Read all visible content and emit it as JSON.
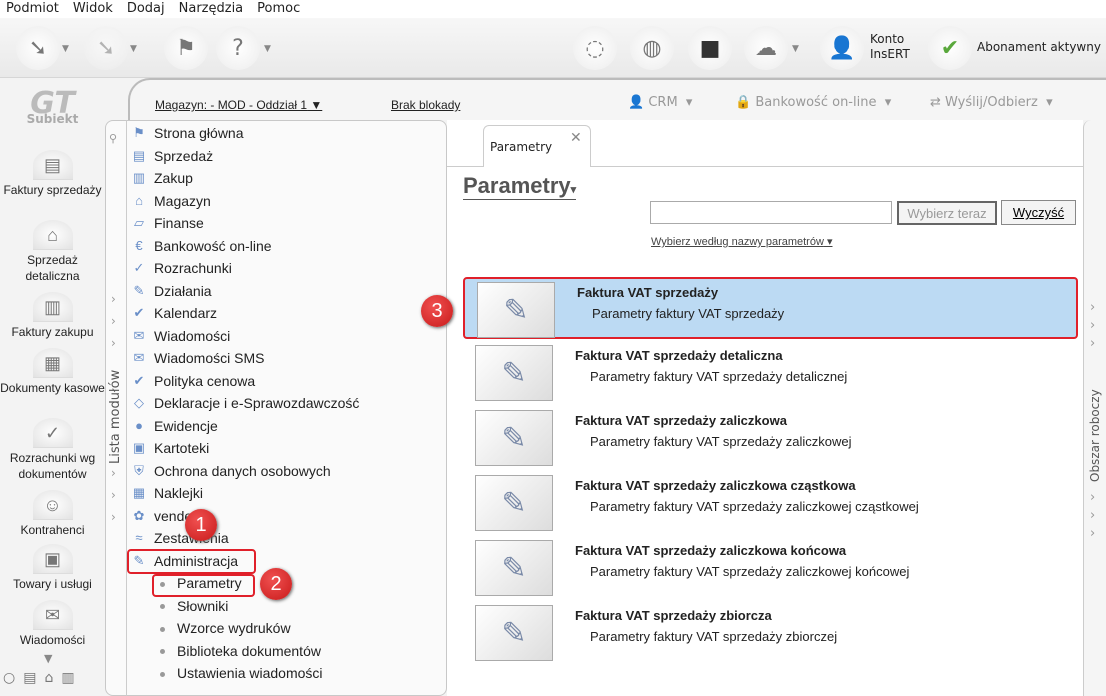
{
  "menu": [
    "Podmiot",
    "Widok",
    "Dodaj",
    "Narzędzia",
    "Pomoc"
  ],
  "toolbar": {
    "account_line1": "Konto",
    "account_line2": "InsERT",
    "subscription": "Abonament aktywny",
    "logo_text": "Subiekt"
  },
  "sidebar": [
    "Faktury sprzedaży",
    "Sprzedaż detaliczna",
    "Faktury zakupu",
    "Dokumenty kasowe",
    "Rozrachunki wg dokumentów",
    "Kontrahenci",
    "Towary i usługi",
    "Wiadomości"
  ],
  "panelbar": {
    "warehouse": "Magazyn: - MOD - Oddział 1",
    "lock": "Brak blokady",
    "crm": "CRM",
    "banking": "Bankowość on-line",
    "send": "Wyślij/Odbierz"
  },
  "modules_tab": "Lista modułów",
  "modules": [
    "Strona główna",
    "Sprzedaż",
    "Zakup",
    "Magazyn",
    "Finanse",
    "Bankowość on-line",
    "Rozrachunki",
    "Działania",
    "Kalendarz",
    "Wiadomości",
    "Wiadomości SMS",
    "Polityka cenowa",
    "Deklaracje i e-Sprawozdawczość",
    "Ewidencje",
    "Kartoteki",
    "Ochrona danych osobowych",
    "Naklejki",
    "vendero",
    "Zestawienia",
    "Administracja"
  ],
  "submodules": [
    "Parametry",
    "Słowniki",
    "Wzorce wydruków",
    "Biblioteka dokumentów",
    "Ustawienia wiadomości"
  ],
  "content": {
    "tab": "Parametry",
    "title": "Parametry",
    "search_value": "",
    "choose_btn": "Wybierz teraz",
    "clear_btn": "Wyczyść",
    "filter_link": "Wybierz według nazwy parametrów",
    "items": [
      {
        "title": "Faktura VAT sprzedaży",
        "desc": "Parametry faktury VAT sprzedaży"
      },
      {
        "title": "Faktura VAT sprzedaży detaliczna",
        "desc": "Parametry faktury VAT sprzedaży detalicznej"
      },
      {
        "title": "Faktura VAT sprzedaży zaliczkowa",
        "desc": "Parametry faktury VAT sprzedaży zaliczkowej"
      },
      {
        "title": "Faktura VAT sprzedaży zaliczkowa cząstkowa",
        "desc": "Parametry faktury VAT sprzedaży zaliczkowej cząstkowej"
      },
      {
        "title": "Faktura VAT sprzedaży zaliczkowa końcowa",
        "desc": "Parametry faktury VAT sprzedaży zaliczkowej końcowej"
      },
      {
        "title": "Faktura VAT sprzedaży zbiorcza",
        "desc": "Parametry faktury VAT sprzedaży zbiorczej"
      }
    ]
  },
  "workspace_tab": "Obszar roboczy",
  "badges": [
    "1",
    "2",
    "3"
  ],
  "colors": {
    "selection": "#bcdaf3",
    "highlight": "#e0202a"
  }
}
